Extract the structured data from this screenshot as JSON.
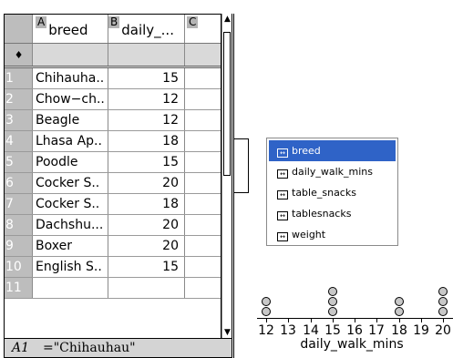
{
  "spreadsheet": {
    "columns": [
      {
        "letter": "A",
        "header": "breed"
      },
      {
        "letter": "B",
        "header": "daily_..."
      },
      {
        "letter": "C",
        "header": ""
      }
    ],
    "formula_row_symbol": "♦",
    "rows": [
      {
        "num": "1",
        "breed": "Chihauha..",
        "daily": "15"
      },
      {
        "num": "2",
        "breed": "Chow−ch..",
        "daily": "12"
      },
      {
        "num": "3",
        "breed": "Beagle",
        "daily": "12"
      },
      {
        "num": "4",
        "breed": "Lhasa Ap..",
        "daily": "18"
      },
      {
        "num": "5",
        "breed": "Poodle",
        "daily": "15"
      },
      {
        "num": "6",
        "breed": "Cocker S..",
        "daily": "20"
      },
      {
        "num": "7",
        "breed": "Cocker S..",
        "daily": "18"
      },
      {
        "num": "8",
        "breed": "Dachshu...",
        "daily": "20"
      },
      {
        "num": "9",
        "breed": "Boxer",
        "daily": "20"
      },
      {
        "num": "10",
        "breed": "English S..",
        "daily": "15"
      },
      {
        "num": "11",
        "breed": "",
        "daily": ""
      }
    ]
  },
  "status": {
    "cell_ref": "A1",
    "cell_value": "=\"Chihauhau\""
  },
  "variable_menu": {
    "items": [
      "breed",
      "daily_walk_mins",
      "table_snacks",
      "tablesnacks",
      "weight"
    ],
    "selected": "breed",
    "icon_glyph": "↔"
  },
  "dot_plot": {
    "tick_labels": [
      "12",
      "13",
      "14",
      "15",
      "16",
      "17",
      "18",
      "19",
      "20"
    ],
    "axis_title": "daily_walk_mins"
  },
  "chart_data": {
    "type": "scatter",
    "variable": "daily_walk_mins",
    "x": [
      12,
      12,
      15,
      15,
      15,
      18,
      18,
      20,
      20,
      20
    ],
    "xlabel": "daily_walk_mins",
    "xlim": [
      11.5,
      20.5
    ],
    "counts": {
      "12": 2,
      "15": 3,
      "18": 2,
      "20": 3
    }
  }
}
